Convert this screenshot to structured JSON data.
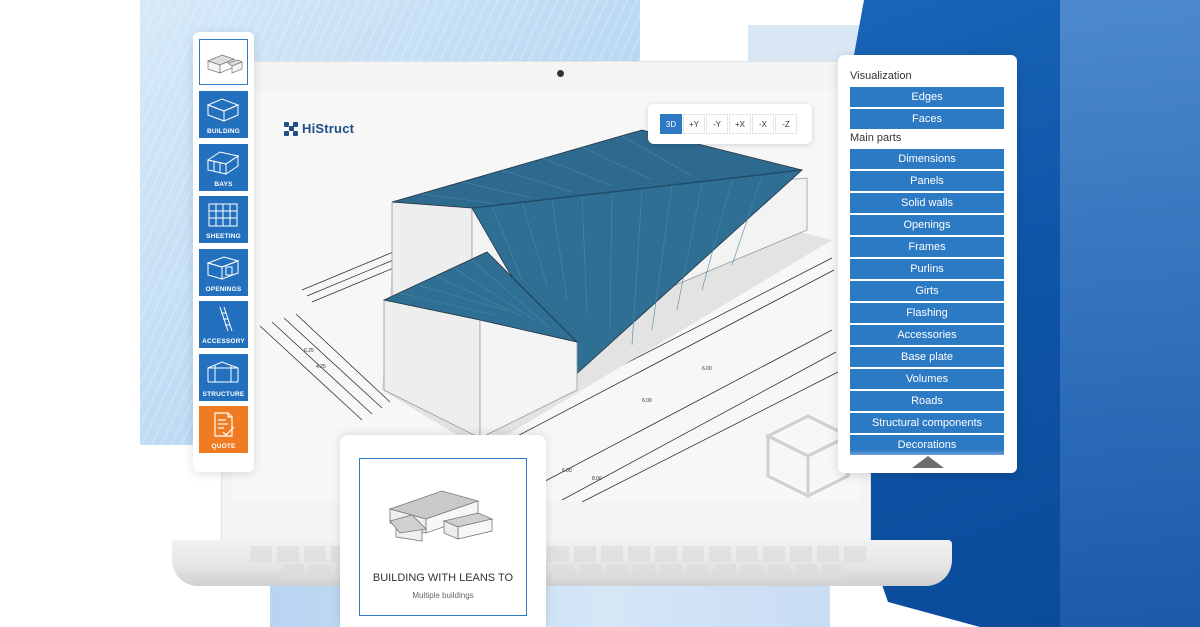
{
  "app": {
    "logo_text": "HiStruct",
    "accent_color": "#2d7ac4",
    "quote_color": "#f07b22"
  },
  "view_toolbar": {
    "buttons": [
      "3D",
      "+Y",
      "-Y",
      "+X",
      "-X",
      "-Z"
    ],
    "active": "3D"
  },
  "steps": {
    "items": [
      {
        "label": "BUILDING",
        "icon": "building-icon"
      },
      {
        "label": "BAYS",
        "icon": "bays-icon"
      },
      {
        "label": "SHEETING",
        "icon": "sheeting-icon"
      },
      {
        "label": "OPENINGS",
        "icon": "openings-icon"
      },
      {
        "label": "ACCESSORY",
        "icon": "accessory-icon"
      },
      {
        "label": "STRUCTURE",
        "icon": "structure-icon"
      },
      {
        "label": "QUOTE",
        "icon": "quote-icon"
      }
    ]
  },
  "parts_panel": {
    "visualization_label": "Visualization",
    "visualization": [
      "Edges",
      "Faces"
    ],
    "main_parts_label": "Main parts",
    "main_parts": [
      "Dimensions",
      "Panels",
      "Solid walls",
      "Openings",
      "Frames",
      "Purlins",
      "Girts",
      "Flashing",
      "Accessories",
      "Base plate",
      "Volumes",
      "Roads",
      "Structural components",
      "Decorations"
    ]
  },
  "building_card": {
    "title": "BUILDING WITH LEANS TO",
    "subtitle": "Multiple buildings"
  }
}
